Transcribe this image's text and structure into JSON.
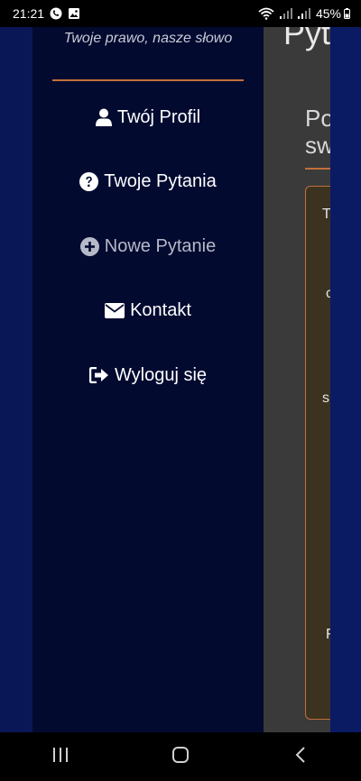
{
  "status_bar": {
    "time": "21:21",
    "battery": "45%"
  },
  "drawer": {
    "tagline": "Twoje prawo, nasze słowo",
    "items": [
      {
        "label": "Twój Profil",
        "icon": "user-icon"
      },
      {
        "label": "Twoje Pytania",
        "icon": "question-circle-icon"
      },
      {
        "label": "Nowe Pytanie",
        "icon": "plus-circle-icon",
        "active": true
      },
      {
        "label": "Kontakt",
        "icon": "envelope-icon"
      },
      {
        "label": "Wyloguj się",
        "icon": "sign-out-icon"
      }
    ]
  },
  "background_page": {
    "title": "Pyt",
    "heading_line1": "Po",
    "heading_line2": "sw",
    "card_letters": [
      "T",
      "c",
      "s",
      "F"
    ]
  },
  "colors": {
    "drawer_bg": "#020a30",
    "accent_divider": "#c0703a",
    "outer_blue": "#0a1757",
    "dim_page": "#3a3a3a"
  }
}
